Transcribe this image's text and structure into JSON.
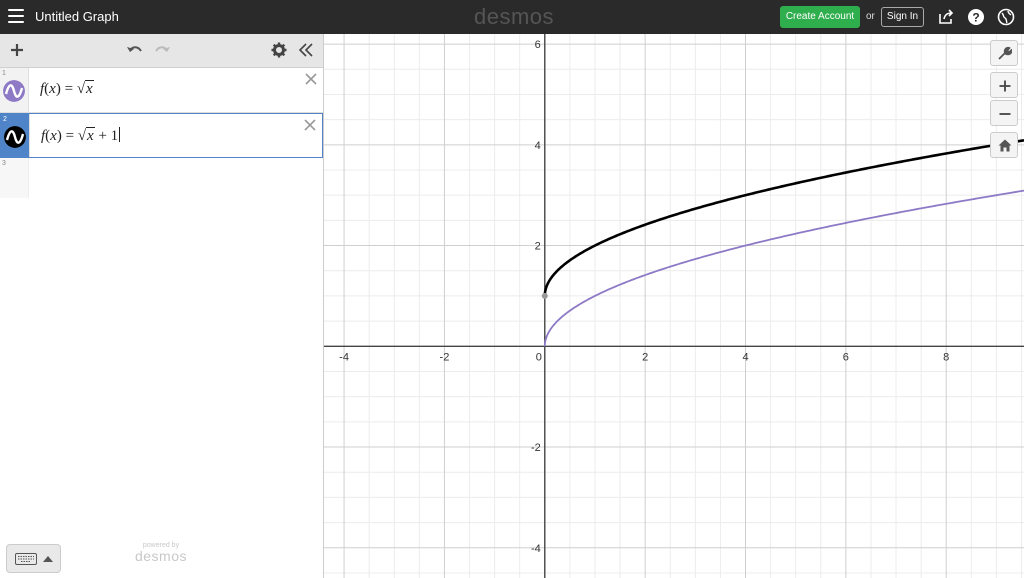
{
  "app": {
    "title": "Untitled Graph",
    "brand": "desmos",
    "create_account_label": "Create Account",
    "or_label": "or",
    "sign_in_label": "Sign In"
  },
  "colors": {
    "topbar": "#2a2a2a",
    "create_account": "#2fae4e",
    "active_blue": "#4f85c8",
    "curve1": "#8d79c6",
    "curve2": "#000000"
  },
  "toolbar": {
    "icons": [
      "plus-icon",
      "undo-icon",
      "redo-icon",
      "gear-icon",
      "collapse-icon"
    ]
  },
  "expressions": [
    {
      "index": "1",
      "latex_lhs": "f",
      "latex_arg": "x",
      "latex_rhs_var": "x",
      "suffix": "",
      "color": "#8d79c6",
      "active": false
    },
    {
      "index": "2",
      "latex_lhs": "f",
      "latex_arg": "x",
      "latex_rhs_var": "x",
      "suffix": "+ 1",
      "color": "#000000",
      "active": true
    },
    {
      "index": "3"
    }
  ],
  "footer": {
    "powered_by": "powered by",
    "brand": "desmos"
  },
  "chart_data": {
    "type": "line",
    "xlim": [
      -4.4,
      9.55
    ],
    "ylim": [
      -4.6,
      6.2
    ],
    "x_ticks": [
      "-4",
      "-2",
      "0",
      "2",
      "4",
      "6",
      "8"
    ],
    "y_ticks": [
      "6",
      "4",
      "2",
      "-2",
      "-4"
    ],
    "grid": true,
    "series": [
      {
        "name": "f(x) = √x",
        "function": "sqrt(x)",
        "color": "#8d79c6",
        "start_point": [
          0,
          0
        ]
      },
      {
        "name": "f(x) = √x + 1",
        "function": "sqrt(x)+1",
        "color": "#000000",
        "start_point": [
          0,
          1
        ]
      }
    ]
  }
}
